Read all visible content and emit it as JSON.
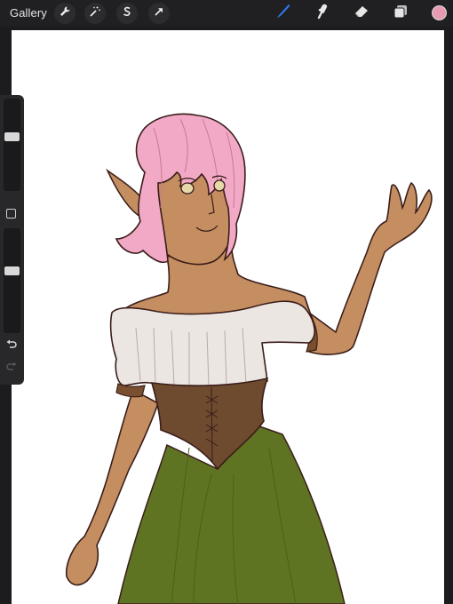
{
  "toolbar": {
    "gallery_label": "Gallery",
    "left_icons": [
      "wrench-icon",
      "magic-wand-icon",
      "selection-icon",
      "transform-arrow-icon"
    ],
    "right_icons": [
      "brush-icon",
      "smudge-icon",
      "eraser-icon",
      "layers-icon"
    ],
    "active_tool": "brush",
    "accent_color": "#2f7cf6",
    "current_color": "#e79bb0"
  },
  "sidebar": {
    "brush_size_level": 0.6,
    "opacity_level": 0.6,
    "icons": [
      "modify-square-icon",
      "undo-icon",
      "redo-icon"
    ]
  },
  "canvas": {
    "background": "#ffffff",
    "palette": {
      "hair": "#f2a9c6",
      "skin": "#c58e60",
      "blouse": "#ece6e2",
      "corset": "#6e4a2f",
      "skirt": "#5f7422",
      "sleeve_band": "#7a4f2f",
      "outline": "#3a1d1a"
    }
  }
}
